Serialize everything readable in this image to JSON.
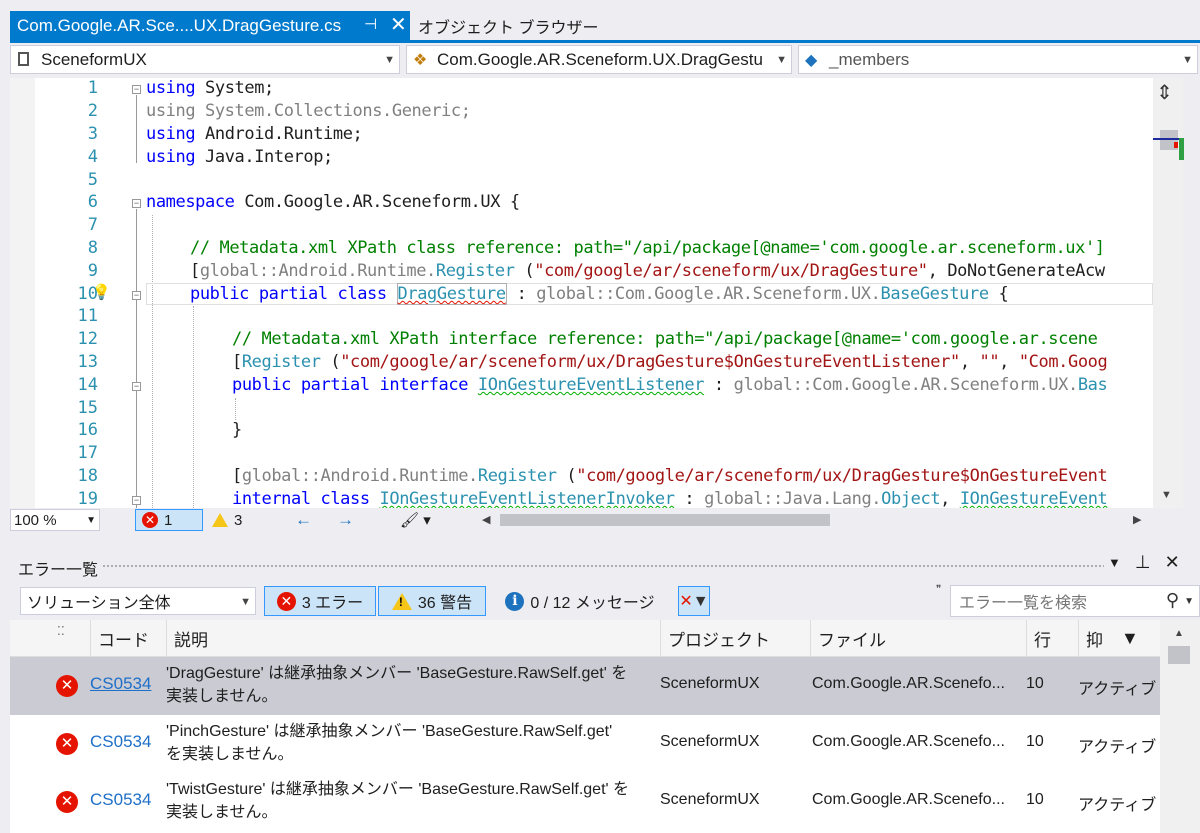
{
  "tabs": {
    "active": "Com.Google.AR.Sce....UX.DragGesture.cs",
    "inactive": "オブジェクト ブラウザー"
  },
  "navbar": {
    "project": "SceneformUX",
    "type": "Com.Google.AR.Sceneform.UX.DragGestu",
    "member": "_members"
  },
  "editor": {
    "lines": [
      "1",
      "2",
      "3",
      "4",
      "5",
      "6",
      "7",
      "8",
      "9",
      "10",
      "11",
      "12",
      "13",
      "14",
      "15",
      "16",
      "17",
      "18",
      "19"
    ],
    "code": {
      "l1a": "using",
      "l1b": " System;",
      "l2": "using System.Collections.Generic;",
      "l3a": "using",
      "l3b": " Android.Runtime;",
      "l4a": "using",
      "l4b": " Java.Interop;",
      "l6a": "namespace",
      "l6b": " Com.Google.AR.Sceneform.UX {",
      "l8": "// Metadata.xml XPath class reference: path=\"/api/package[@name='com.google.ar.sceneform.ux']",
      "l9a": "[",
      "l9b": "global",
      "l9c": "::Android.Runtime.",
      "l9d": "Register",
      "l9e": " (",
      "l9f": "\"com/google/ar/sceneform/ux/DragGesture\"",
      "l9g": ", DoNotGenerateAcw",
      "l10a": "public partial class",
      "l10b": " ",
      "l10c": "DragGesture",
      "l10d": " : ",
      "l10e": "global",
      "l10f": "::Com.Google.AR.Sceneform.UX.",
      "l10g": "BaseGesture",
      "l10h": " {",
      "l12": "// Metadata.xml XPath interface reference: path=\"/api/package[@name='com.google.ar.scene",
      "l13a": "[",
      "l13b": "Register",
      "l13c": " (",
      "l13d": "\"com/google/ar/sceneform/ux/DragGesture$OnGestureEventListener\"",
      "l13e": ", ",
      "l13f": "\"\"",
      "l13g": ", ",
      "l13h": "\"Com.Goog",
      "l14a": "public partial interface",
      "l14b": " ",
      "l14c": "IOnGestureEventListener",
      "l14d": " : ",
      "l14e": "global",
      "l14f": "::Com.Google.AR.Sceneform.UX.",
      "l14g": "Bas",
      "l16": "}",
      "l18a": "[",
      "l18b": "global",
      "l18c": "::Android.Runtime.",
      "l18d": "Register",
      "l18e": " (",
      "l18f": "\"com/google/ar/sceneform/ux/DragGesture$OnGestureEvent",
      "l19a": "internal class",
      "l19b": " ",
      "l19c": "IOnGestureEventListenerInvoker",
      "l19d": " : ",
      "l19e": "global",
      "l19f": "::Java.Lang.",
      "l19g": "Object",
      "l19h": ", ",
      "l19i": "IOnGestureEvent"
    }
  },
  "editor_status": {
    "zoom": "100 %",
    "errors": "1",
    "warnings": "3"
  },
  "error_list": {
    "title": "エラー一覧",
    "scope": "ソリューション全体",
    "errors_btn": "3 エラー",
    "warnings_btn": "36 警告",
    "messages_btn": "0 / 12 メッセージ",
    "search_placeholder": "エラー一覧を検索",
    "columns": {
      "code": "コード",
      "description": "説明",
      "project": "プロジェクト",
      "file": "ファイル",
      "line": "行",
      "suppression": "抑"
    },
    "rows": [
      {
        "code": "CS0534",
        "desc1": "'DragGesture' は継承抽象メンバー 'BaseGesture.RawSelf.get' を",
        "desc2": "実装しません。",
        "project": "SceneformUX",
        "file": "Com.Google.AR.Scenefo...",
        "line": "10",
        "state": "アクティブ"
      },
      {
        "code": "CS0534",
        "desc1": "'PinchGesture' は継承抽象メンバー 'BaseGesture.RawSelf.get'",
        "desc2": "を実装しません。",
        "project": "SceneformUX",
        "file": "Com.Google.AR.Scenefo...",
        "line": "10",
        "state": "アクティブ"
      },
      {
        "code": "CS0534",
        "desc1": "'TwistGesture' は継承抽象メンバー 'BaseGesture.RawSelf.get' を",
        "desc2": "実装しません。",
        "project": "SceneformUX",
        "file": "Com.Google.AR.Scenefo...",
        "line": "10",
        "state": "アクティブ"
      }
    ]
  },
  "colors": {
    "accent": "#007acc",
    "keyword": "#0000ff",
    "comment": "#008000",
    "string": "#a31515",
    "type": "#2b91af",
    "error": "#e51400"
  }
}
